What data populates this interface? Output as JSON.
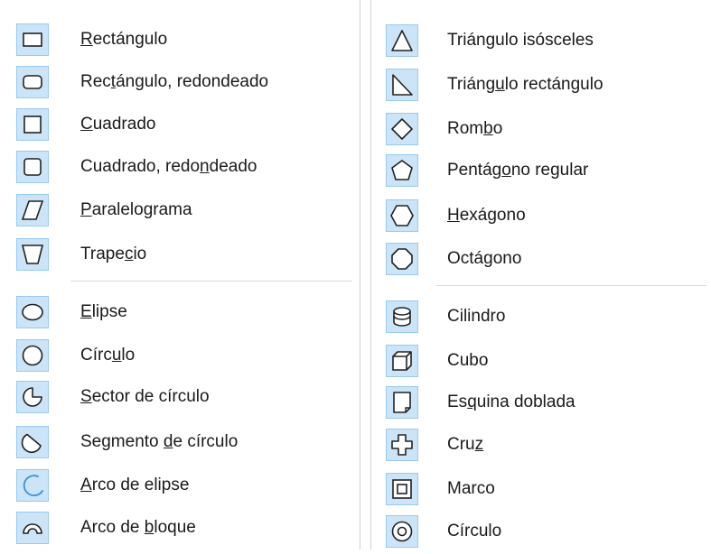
{
  "left_menu": {
    "items": [
      {
        "pre": "",
        "mn": "R",
        "post": "ectángulo",
        "icon": "rectangle-icon"
      },
      {
        "pre": "Rec",
        "mn": "t",
        "post": "ángulo, redondeado",
        "icon": "rounded-rectangle-icon"
      },
      {
        "pre": "",
        "mn": "C",
        "post": "uadrado",
        "icon": "square-icon"
      },
      {
        "pre": "Cuadrado, redo",
        "mn": "n",
        "post": "deado",
        "icon": "rounded-square-icon"
      },
      {
        "pre": "",
        "mn": "P",
        "post": "aralelograma",
        "icon": "parallelogram-icon"
      },
      {
        "pre": "Trape",
        "mn": "c",
        "post": "io",
        "icon": "trapezoid-icon"
      },
      {
        "pre": "",
        "mn": "E",
        "post": "lipse",
        "icon": "ellipse-icon"
      },
      {
        "pre": "Círc",
        "mn": "u",
        "post": "lo",
        "icon": "circle-icon"
      },
      {
        "pre": "",
        "mn": "S",
        "post": "ector de círculo",
        "icon": "circle-sector-icon"
      },
      {
        "pre": "Segmento ",
        "mn": "d",
        "post": "e círculo",
        "icon": "circle-segment-icon"
      },
      {
        "pre": "",
        "mn": "A",
        "post": "rco de elipse",
        "icon": "ellipse-arc-icon"
      },
      {
        "pre": "Arco de ",
        "mn": "b",
        "post": "loque",
        "icon": "block-arc-icon"
      }
    ]
  },
  "right_menu": {
    "items": [
      {
        "pre": "Triángulo isósceles",
        "mn": "",
        "post": "",
        "icon": "isosceles-triangle-icon"
      },
      {
        "pre": "Triáng",
        "mn": "u",
        "post": "lo rectángulo",
        "icon": "right-triangle-icon"
      },
      {
        "pre": "Rom",
        "mn": "b",
        "post": "o",
        "icon": "diamond-icon"
      },
      {
        "pre": "Pentág",
        "mn": "o",
        "post": "no regular",
        "icon": "pentagon-icon"
      },
      {
        "pre": "",
        "mn": "H",
        "post": "exágono",
        "icon": "hexagon-icon"
      },
      {
        "pre": "Octágono",
        "mn": "",
        "post": "",
        "icon": "octagon-icon"
      },
      {
        "pre": "Cilindro",
        "mn": "",
        "post": "",
        "icon": "cylinder-icon"
      },
      {
        "pre": "Cubo",
        "mn": "",
        "post": "",
        "icon": "cube-icon"
      },
      {
        "pre": "Es",
        "mn": "q",
        "post": "uina doblada",
        "icon": "folded-corner-icon"
      },
      {
        "pre": "Cru",
        "mn": "z",
        "post": "",
        "icon": "cross-icon"
      },
      {
        "pre": "Marco",
        "mn": "",
        "post": "",
        "icon": "frame-icon"
      },
      {
        "pre": "Círculo",
        "mn": "",
        "post": "",
        "icon": "ring-icon"
      }
    ]
  },
  "colors": {
    "icon_highlight": "#cce4f7",
    "icon_border": "#99c9ef",
    "stroke": "#222222",
    "arc_accent": "#3b8fd9"
  }
}
